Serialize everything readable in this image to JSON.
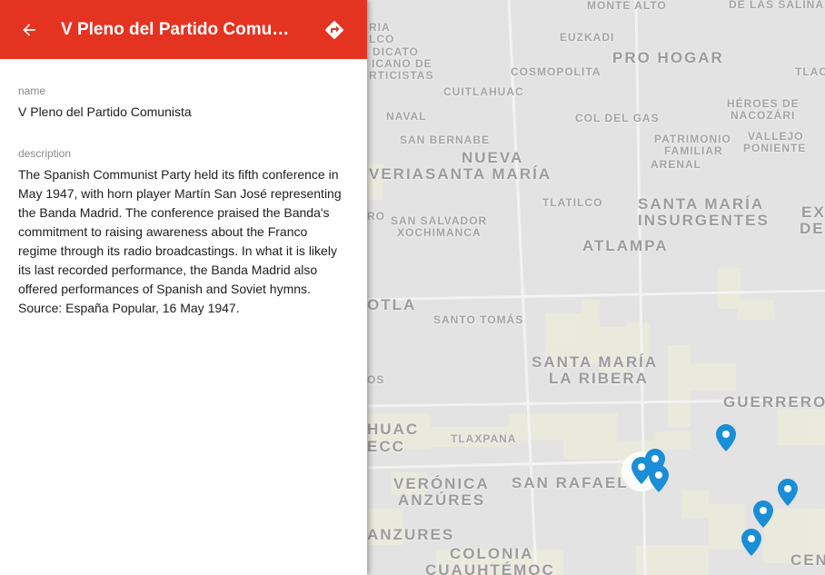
{
  "panel": {
    "title": "V Pleno del Partido Comunista",
    "fields": {
      "name_label": "name",
      "name_value": "V Pleno del Partido Comunista",
      "description_label": "description",
      "description_value": "The Spanish Communist Party held its fifth conference in May 1947, with horn player Martín San José representing the Banda Madrid. The conference praised the Banda's commitment to raising awareness about the Franco regime through its radio broadcastings. In what it is likely its last recorded performance, the Banda Madrid also offered performances of Spanish and Soviet hymns. Source: España Popular, 16 May 1947."
    },
    "icons": {
      "back": "arrow-left-icon",
      "directions": "directions-icon"
    }
  },
  "map": {
    "labels": {
      "monte_alto": "MONTE ALTO",
      "de_las_salinas": "DE LAS SALINA",
      "euzkadi": "EUZKADI",
      "pro_hogar": "PRO HOGAR",
      "cosmopolita": "COSMOPOLITA",
      "tlac": "TLAC",
      "sindicato_1": "RIA",
      "sindicato_2": "LCO",
      "sindicato_3": "DICATO",
      "sindicato_4": "ICANO DE",
      "sindicato_5": "RTICISTAS",
      "cuitlahuac": "CUITLAHUAC",
      "heroes_1": "HÉROES DE",
      "heroes_2": "NACOZÁRI",
      "naval": "NAVAL",
      "col_del_gas": "COL DEL GAS",
      "san_bernabe": "SAN BERNABE",
      "patrimonio_1": "PATRIMONIO",
      "patrimonio_2": "FAMILIAR",
      "vallejo_1": "VALLEJO",
      "vallejo_2": "PONIENTE",
      "arenal": "ARENAL",
      "nueva": "NUEVA",
      "veria": "VERIA",
      "santa_maria": "SANTA MARÍA",
      "tlatilco": "TLATILCO",
      "smi_1": "SANTA MARÍA",
      "smi_2": "INSURGENTES",
      "ex_1": "EX",
      "ex_2": "DE",
      "ro": "RO",
      "san_salvador_1": "SAN SALVADOR",
      "san_salvador_2": "XOCHIMANCA",
      "atlampa": "ATLAMPA",
      "otla": "OTLA",
      "santo_tomas": "SANTO TOMÁS",
      "ribera_1": "SANTA MARÍA",
      "ribera_2": "LA RIBERA",
      "os": "OS",
      "guerrero": "GUERRERO",
      "huac": "HUAC",
      "ecc": "ECC",
      "tlaxpana": "TLAXPANA",
      "veronica_1": "VERÓNICA",
      "veronica_2": "ANZÚRES",
      "san_rafael": "SAN RAFAEL",
      "anzures": "ANZURES",
      "colonia": "COLONIA",
      "cuauhtemoc": "CUAUHTÉMOC",
      "cen": "CEN"
    },
    "marker_color": "#1a8ed6",
    "marker_count": 6
  },
  "colors": {
    "header": "#e53322",
    "map_bg": "#e3e3e3",
    "map_blocks": "#ececdf",
    "label": "#a4a4a4"
  }
}
